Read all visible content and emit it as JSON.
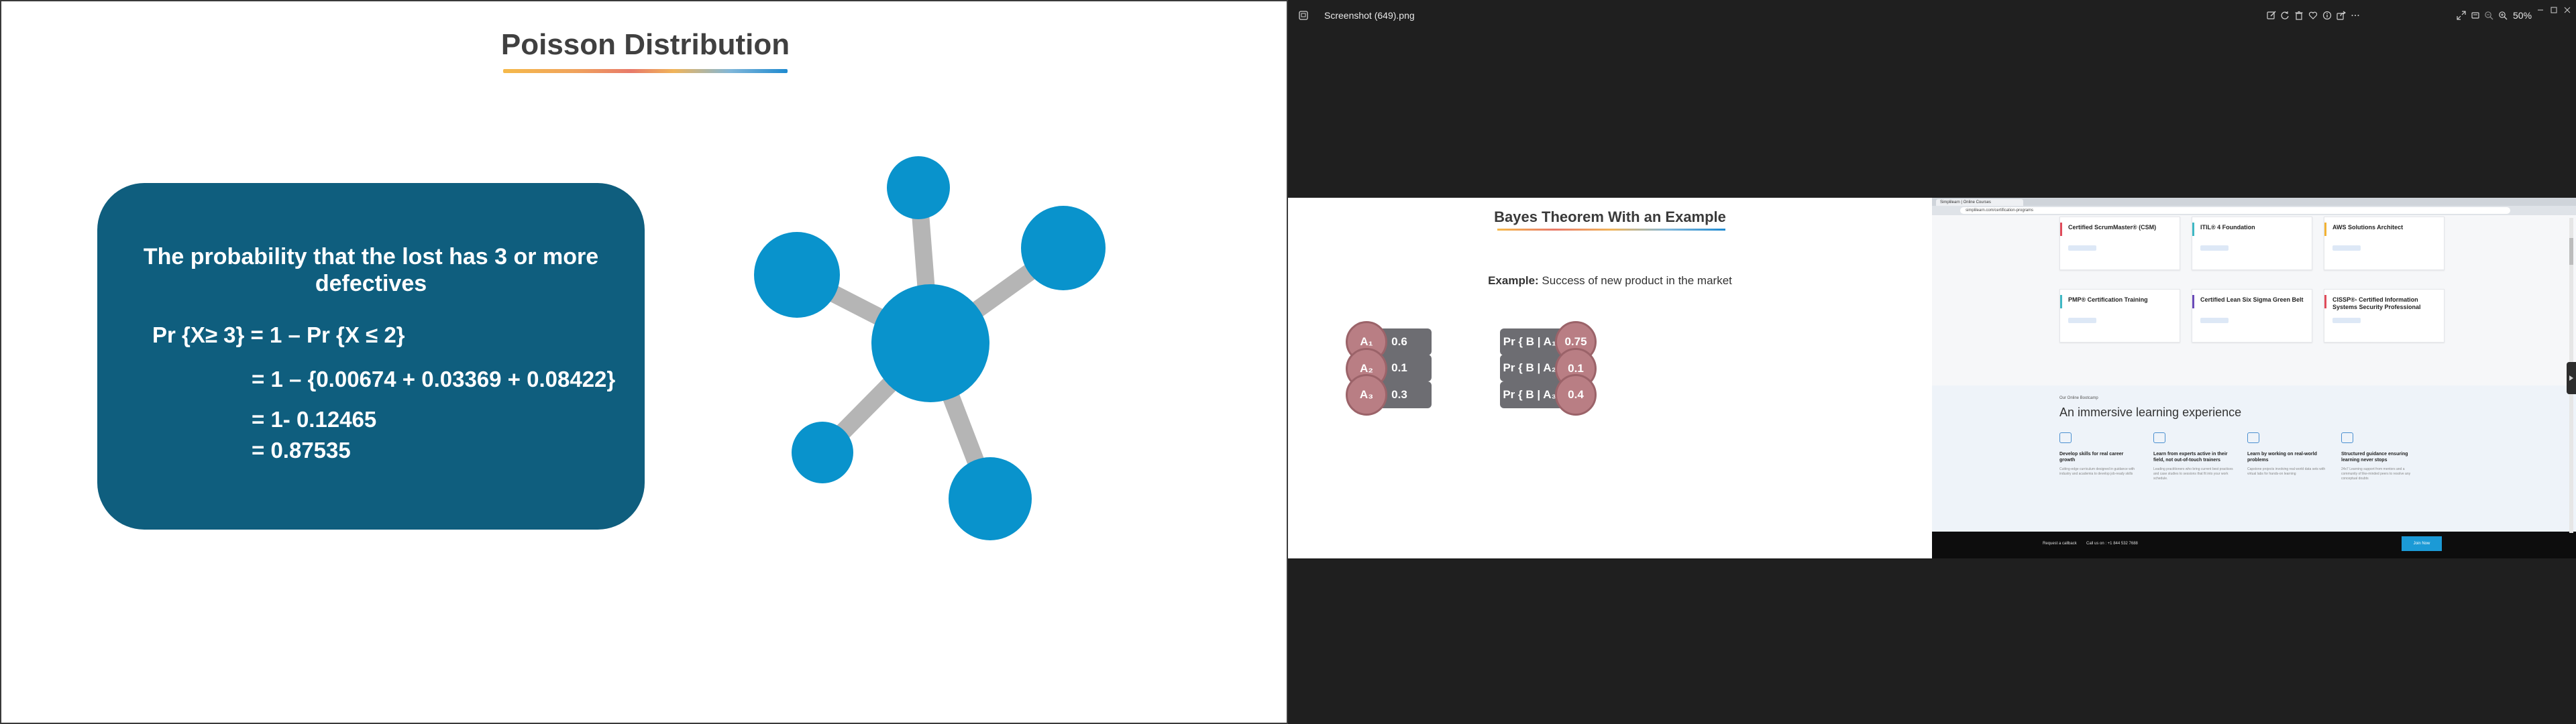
{
  "slide_left": {
    "title": "Poisson Distribution",
    "card_heading": "The probability that the lost has 3 or more defectives",
    "lines": [
      "Pr {X≥ 3} = 1 – Pr {X ≤ 2}",
      "= 1 – {0.00674 + 0.03369 + 0.08422}",
      "= 1- 0.12465",
      "= 0.87535"
    ]
  },
  "viewer": {
    "file_name": "Screenshot (649).png",
    "zoom": "50%",
    "icons": [
      "gallery-icon",
      "edit-icon",
      "rotate-icon",
      "delete-icon",
      "favorite-icon",
      "info-icon",
      "share-icon",
      "more-icon",
      "fullscreen-icon",
      "crop-icon",
      "zoom-out-icon",
      "zoom-in-icon",
      "minimize-icon",
      "maximize-icon",
      "close-icon"
    ]
  },
  "bayes": {
    "title": "Bayes Theorem With an Example",
    "example_label": "Example:",
    "example_text": " Success of new product in the market",
    "rows": [
      {
        "a": "A₁",
        "a_val": "0.6",
        "b": "Pr { B | A₁ }",
        "b_val": "0.75"
      },
      {
        "a": "A₂",
        "a_val": "0.1",
        "b": "Pr { B | A₂ }",
        "b_val": "0.1"
      },
      {
        "a": "A₃",
        "a_val": "0.3",
        "b": "Pr { B | A₃ }",
        "b_val": "0.4"
      }
    ]
  },
  "browser": {
    "tab_title": "Simplilearn | Online Courses",
    "address": "simplilearn.com/certification-programs",
    "courses": [
      {
        "name": "Certified ScrumMaster® (CSM)",
        "color": "#e04b5a"
      },
      {
        "name": "ITIL® 4 Foundation",
        "color": "#3fb8c4"
      },
      {
        "name": "AWS Solutions Architect",
        "color": "#f2b233"
      },
      {
        "name": "PMP® Certification Training",
        "color": "#3fb8c4"
      },
      {
        "name": "Certified Lean Six Sigma Green Belt",
        "color": "#6b4bb8"
      },
      {
        "name": "CISSP®- Certified Information Systems Security Professional",
        "color": "#e04b5a"
      }
    ],
    "section_sub": "Our Online Bootcamp",
    "section_title": "An immersive learning experience",
    "features": [
      {
        "title": "Develop skills for real career growth",
        "desc": "Cutting-edge curriculum designed in guidance with industry and academia to develop job-ready skills"
      },
      {
        "title": "Learn from experts active in their field, not out-of-touch trainers",
        "desc": "Leading practitioners who bring current best practices and case studies to sessions that fit into your work schedule."
      },
      {
        "title": "Learn by working on real-world problems",
        "desc": "Capstone projects involving real world data sets with virtual labs for hands-on learning"
      },
      {
        "title": "Structured guidance ensuring learning never stops",
        "desc": "24x7 Learning support from mentors and a community of like-minded peers to resolve any conceptual doubts"
      }
    ],
    "footer": {
      "callback": "Request a callback",
      "call": "Call us on : +1 844 532 7688",
      "enroll": "Join Now"
    }
  }
}
